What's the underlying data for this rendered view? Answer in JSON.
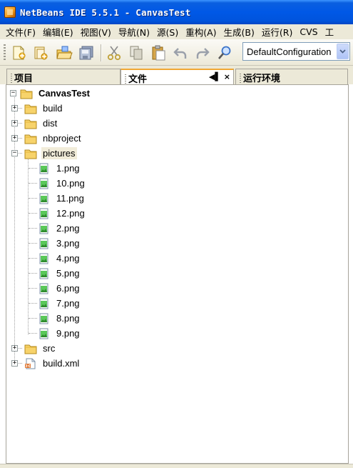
{
  "window": {
    "title": "NetBeans IDE 5.5.1 - CanvasTest"
  },
  "menubar": {
    "items": [
      "文件(F)",
      "编辑(E)",
      "视图(V)",
      "导航(N)",
      "源(S)",
      "重构(A)",
      "生成(B)",
      "运行(R)",
      "CVS",
      "工"
    ]
  },
  "toolbar": {
    "buttons": [
      "new-file-icon",
      "new-project-icon",
      "open-project-icon",
      "save-all-icon",
      "cut-icon",
      "copy-icon",
      "paste-icon",
      "undo-icon",
      "redo-icon",
      "find-icon"
    ],
    "configuration": "DefaultConfiguration"
  },
  "tabs": {
    "projects": "项目",
    "files": "文件",
    "runtime": "运行环境",
    "controls": {
      "minimize": "◀▌",
      "close": "×"
    }
  },
  "tree": {
    "root": "CanvasTest",
    "items": [
      {
        "label": "build",
        "type": "folder",
        "expanded": false
      },
      {
        "label": "dist",
        "type": "folder",
        "expanded": false
      },
      {
        "label": "nbproject",
        "type": "folder",
        "expanded": false
      },
      {
        "label": "pictures",
        "type": "folder",
        "expanded": true,
        "selected": true
      },
      {
        "label": "1.png",
        "type": "image"
      },
      {
        "label": "10.png",
        "type": "image"
      },
      {
        "label": "11.png",
        "type": "image"
      },
      {
        "label": "12.png",
        "type": "image"
      },
      {
        "label": "2.png",
        "type": "image"
      },
      {
        "label": "3.png",
        "type": "image"
      },
      {
        "label": "4.png",
        "type": "image"
      },
      {
        "label": "5.png",
        "type": "image"
      },
      {
        "label": "6.png",
        "type": "image"
      },
      {
        "label": "7.png",
        "type": "image"
      },
      {
        "label": "8.png",
        "type": "image"
      },
      {
        "label": "9.png",
        "type": "image"
      },
      {
        "label": "src",
        "type": "folder",
        "expanded": false
      },
      {
        "label": "build.xml",
        "type": "xml",
        "expanded": false
      }
    ]
  }
}
